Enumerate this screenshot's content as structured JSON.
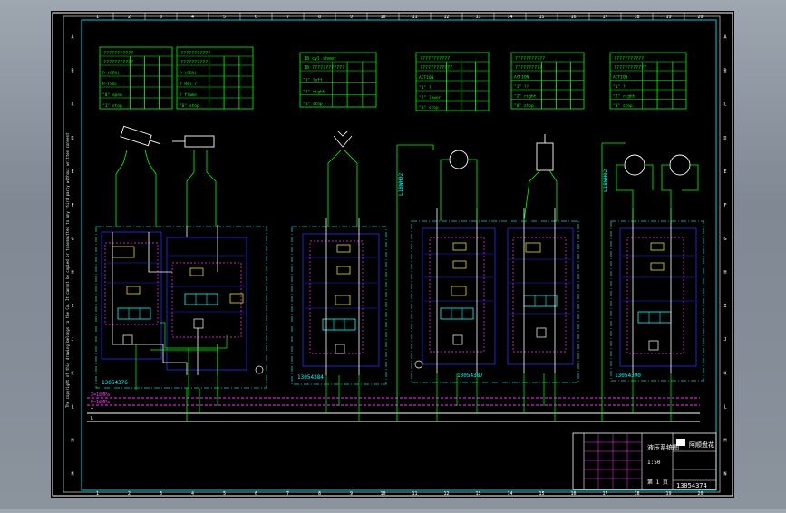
{
  "colors": {
    "sheet": "#000000",
    "border": "#ffffff",
    "frame_cyan": "#00d0d0",
    "line_green": "#00ff00",
    "line_white": "#ffffff",
    "line_blue": "#2b2bff",
    "line_magenta": "#ff30ff",
    "symbol_yellow": "#ffff00",
    "label_cyan": "#00ffff",
    "chrome": "#8b939d"
  },
  "frame": {
    "col_numbers": [
      "1",
      "2",
      "3",
      "4",
      "5",
      "6",
      "7",
      "8",
      "9",
      "10",
      "11",
      "12",
      "13",
      "14",
      "15",
      "16",
      "17",
      "18",
      "19",
      "20"
    ],
    "row_letters_left": [
      "A",
      "B",
      "C",
      "D",
      "E",
      "F",
      "G",
      "H",
      "I",
      "J",
      "K",
      "L",
      "M",
      "N"
    ],
    "row_letters_right": [
      "A",
      "B",
      "C",
      "D",
      "E",
      "F",
      "G",
      "H",
      "I",
      "J",
      "K",
      "L",
      "M",
      "N"
    ],
    "side_note": "The copyright of this drawing belongs to the Co. It cannot be copied or transmitted to any third party without written consent"
  },
  "tables": [
    {
      "title": "???????????",
      "header": "???????????",
      "rows": [
        "P-(SPA)",
        "P-(Sm)",
        "\"0\" open",
        "\"1\" stop"
      ]
    },
    {
      "title": "???????????",
      "header": "??????????",
      "rows": [
        "P-(SPA)",
        "? Rel ?",
        "? flame",
        "\"0\" stop"
      ]
    },
    {
      "title": "18 cyl sheet",
      "header": "18 ????????????",
      "rows": [
        "\"1\" left",
        "\"2\" right",
        "\"0\" stop"
      ]
    },
    {
      "title": "???????????",
      "header": "????????????",
      "rows": [
        "ACTION",
        "\"1\" ?",
        "\"2\" lower",
        "\"0\" stop"
      ]
    },
    {
      "title": "???????????",
      "header": "??????????",
      "rows": [
        "ACTION",
        "\"1\" ??",
        "\"2\" right",
        "\"0\" stop"
      ]
    },
    {
      "title": "???????????",
      "header": "????????????",
      "rows": [
        "ACTION",
        "\"1\" ?",
        "\"2\" right",
        "\"0\" stop"
      ]
    }
  ],
  "blocks": [
    {
      "id": "13054376"
    },
    {
      "id": "13054384"
    },
    {
      "id": "13054387"
    },
    {
      "id": "13054390"
    }
  ],
  "pipes": {
    "vertical_1": "L18WH02",
    "vertical_2": "L18WH02"
  },
  "rails": {
    "pressure_top": "X=18MPa",
    "pressure_p": "P=18MPa",
    "tank_t": "T",
    "line_4": "L"
  },
  "title_block": {
    "company": "阿顺盘花",
    "drawing_name": "液压系统图",
    "drawing_number": "13054374",
    "scale": "1:50",
    "sheet": "第 1 页"
  }
}
